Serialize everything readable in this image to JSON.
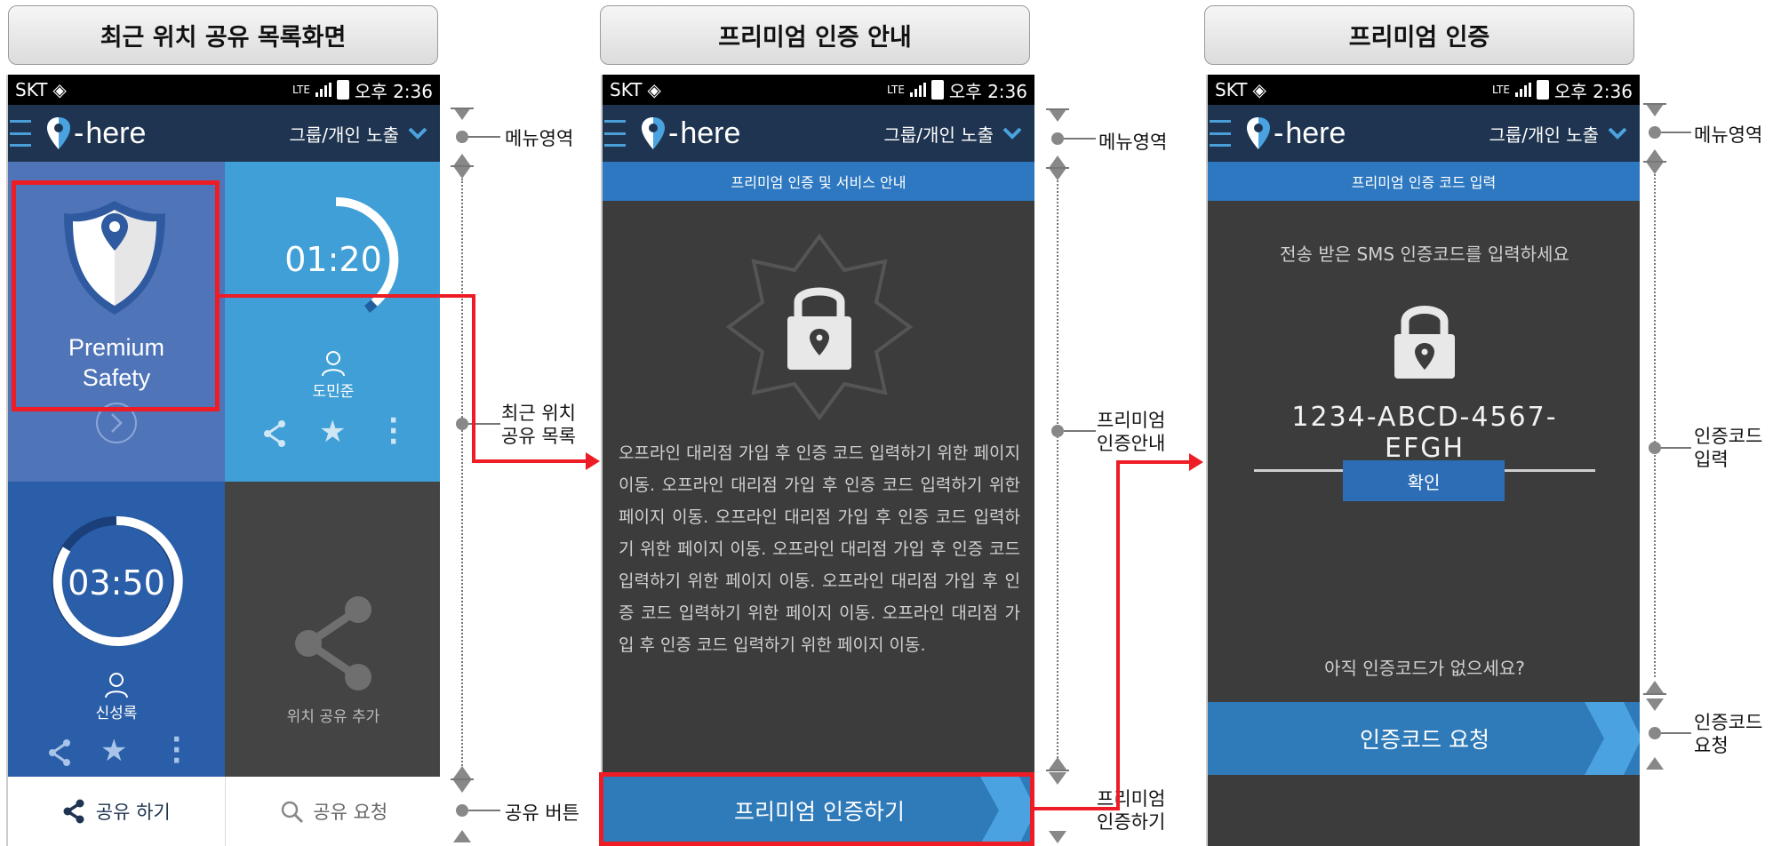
{
  "titles": [
    "최근 위치 공유 목록화면",
    "프리미엄 인증 안내",
    "프리미엄 인증"
  ],
  "status_bar": {
    "carrier": "SKT",
    "network": "LTE",
    "time": "오후 2:36"
  },
  "app_bar": {
    "logo_text": "here",
    "dropdown_label": "그룹/개인 노출"
  },
  "screen1": {
    "tiles": {
      "premium_line1": "Premium",
      "premium_line2": "Safety",
      "timer1": "01:20",
      "user1": "도민준",
      "timer2": "03:50",
      "user2": "신성록",
      "add_share": "위치 공유 추가"
    },
    "tabs": {
      "share": "공유 하기",
      "request": "공유 요청"
    }
  },
  "screen2": {
    "header": "프리미엄 인증 및 서비스 안내",
    "body": "오프라인 대리점 가입 후 인증 코드 입력하기 위한 페이지 이동. 오프라인 대리점 가입 후 인증 코드 입력하기 위한 페이지 이동. 오프라인 대리점 가입 후 인증 코드 입력하기 위한 페이지 이동. 오프라인 대리점 가입 후 인증 코드 입력하기 위한 페이지 이동. 오프라인 대리점 가입 후 인증 코드 입력하기 위한 페이지 이동. 오프라인 대리점 가입 후 인증 코드 입력하기 위한 페이지 이동.",
    "button": "프리미엄 인증하기"
  },
  "screen3": {
    "header": "프리미엄 인증 코드 입력",
    "prompt": "전송 받은 SMS 인증코드를 입력하세요",
    "code": "1234-ABCD-4567-EFGH",
    "confirm": "확인",
    "no_code": "아직 인증코드가 없으세요?",
    "request": "인증코드 요청"
  },
  "annotations": {
    "menu": "메뉴영역",
    "recent_list": [
      "최근 위치",
      "공유 목록"
    ],
    "share_button": "공유 버튼",
    "premium_guide": [
      "프리미엄",
      "인증안내"
    ],
    "premium_auth": [
      "프리미엄",
      "인증하기"
    ],
    "code_input": [
      "인증코드",
      "입력"
    ],
    "code_request": [
      "인증코드",
      "요청"
    ]
  },
  "colors": {
    "highlight_red": "#ee1c25",
    "appbar": "#1f3450",
    "accent_blue": "#2d78c0"
  }
}
